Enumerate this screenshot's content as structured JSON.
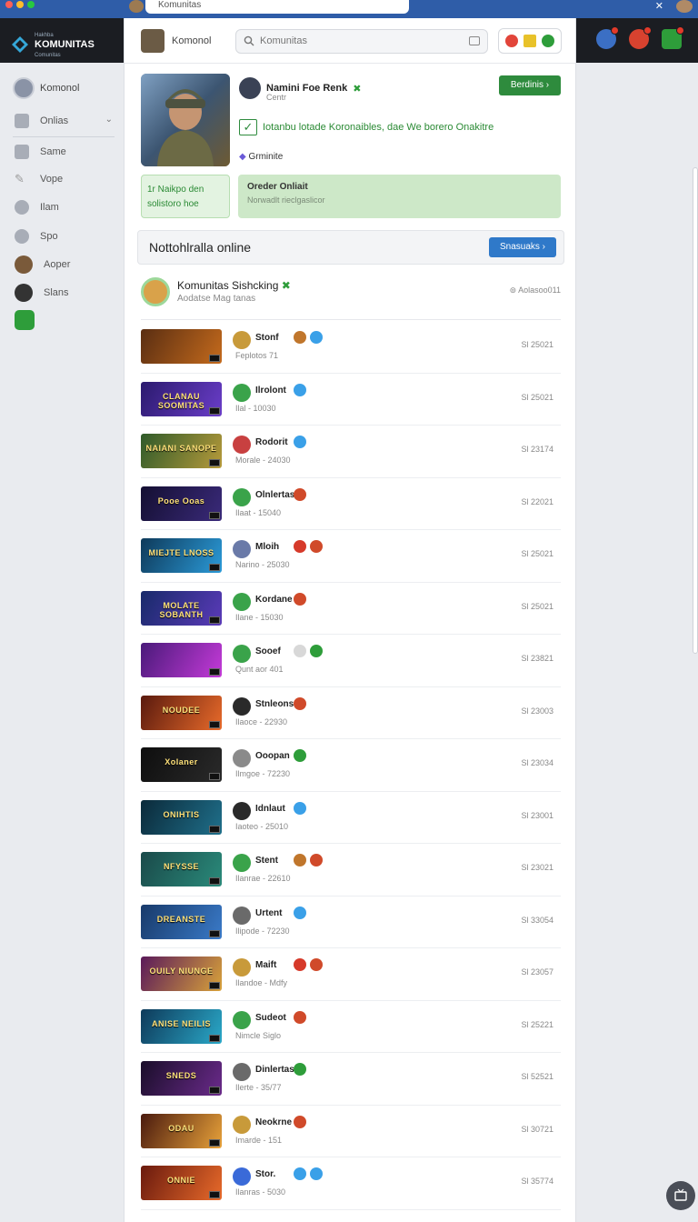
{
  "browser": {
    "tab_title": "Komunitas"
  },
  "header": {
    "brand_line1": "Hakhba",
    "brand_line2": "KOMUNITAS",
    "brand_line3": "Comunitas"
  },
  "sidebar": {
    "user": "Komonol",
    "items": [
      {
        "label": "Onlias",
        "icon": "folder-icon",
        "caret": true
      },
      {
        "label": "Same",
        "icon": "bookmark-icon"
      },
      {
        "label": "Vope",
        "icon": "pencil-icon"
      },
      {
        "label": "Ilam",
        "icon": "letter-e-icon"
      },
      {
        "label": "Spo",
        "icon": "circle-icon"
      },
      {
        "label": "Aoper",
        "icon": "character-icon"
      },
      {
        "label": "Slans",
        "icon": "info-icon"
      },
      {
        "label": "",
        "icon": "chat-icon"
      }
    ]
  },
  "searchrow": {
    "user_name": "Komonol",
    "search_placeholder": "Komunitas"
  },
  "profile": {
    "name": "Namini Foe Renk",
    "subtitle": "Centr",
    "follow_label": "Berdinis",
    "description": "Iotanbu lotade Koronaibles, dae We borero Onakitre",
    "genre": "Grminite",
    "tile_a": "1r Naikpo den solistoro hoe",
    "tile_b_title": "Oreder Onliait",
    "tile_b_sub": "Norwadlt rieclgaslicor"
  },
  "online_bar": {
    "title": "Nottohlralla online",
    "button": "Snasuaks"
  },
  "community": {
    "title": "Komunitas Sishcking",
    "subtitle": "Aodatse Mag tanas",
    "right": "Aolasoo011"
  },
  "rows": [
    {
      "thumb_text": "",
      "name": "Stonf",
      "sub": "Feplotos 71",
      "value": "Sl 25021",
      "thumb_colors": [
        "#5a2e12",
        "#c46a1c"
      ],
      "av": "#c89a3a",
      "icons": [
        "#c0762c",
        "#3aa0e8"
      ]
    },
    {
      "thumb_text": "CLANAU SOOMITAS",
      "name": "Ilrolont",
      "sub": "Ilal - 10030",
      "value": "Sl 25021",
      "thumb_colors": [
        "#2b1a6e",
        "#6a3dc8"
      ],
      "av": "#3aa34a",
      "icons": [
        "#3aa0e8"
      ]
    },
    {
      "thumb_text": "NAIANI SANOPE",
      "name": "Rodorit",
      "sub": "Morale - 24030",
      "value": "Sl 23174",
      "thumb_colors": [
        "#2e5a2a",
        "#b79a3a"
      ],
      "av": "#c84040",
      "icons": [
        "#3aa0e8"
      ]
    },
    {
      "thumb_text": "Pooe Ooas",
      "name": "Olnlertas",
      "sub": "Ilaat - 15040",
      "value": "Sl 22021",
      "thumb_colors": [
        "#140f32",
        "#3a2a7a"
      ],
      "av": "#3aa34a",
      "icons": [
        "#d04a2a"
      ]
    },
    {
      "thumb_text": "MIEJTE LNOSS",
      "name": "Mloih",
      "sub": "Narino - 25030",
      "value": "Sl 25021",
      "thumb_colors": [
        "#0e3a5a",
        "#2b9ad8"
      ],
      "av": "#6a7aa8",
      "icons": [
        "#d63a2a",
        "#d04a2a"
      ]
    },
    {
      "thumb_text": "MOLATE SOBANTH",
      "name": "Kordane",
      "sub": "Ilane - 15030",
      "value": "Sl 25021",
      "thumb_colors": [
        "#182a6a",
        "#5a3ab8"
      ],
      "av": "#3aa34a",
      "icons": [
        "#d04a2a"
      ]
    },
    {
      "thumb_text": "",
      "name": "Sooef",
      "sub": "Qunt aor 401",
      "value": "Sl 23821",
      "thumb_colors": [
        "#4a1a7a",
        "#c43ad8"
      ],
      "av": "#3aa34a",
      "icons": [
        "#d8d8d8",
        "#2e9d3a"
      ]
    },
    {
      "thumb_text": "NOUDEE",
      "name": "Stnleons",
      "sub": "Ilaoce - 22930",
      "value": "Sl 23003",
      "thumb_colors": [
        "#5a1a0e",
        "#e86a2a"
      ],
      "av": "#2a2a2a",
      "icons": [
        "#d04a2a"
      ]
    },
    {
      "thumb_text": "Xolaner",
      "name": "Ooopan",
      "sub": "Ilmgoe - 72230",
      "value": "Sl 23034",
      "thumb_colors": [
        "#0e0e0e",
        "#2a2a2a"
      ],
      "av": "#8a8a8a",
      "icons": [
        "#2e9d3a"
      ]
    },
    {
      "thumb_text": "ONIHTIS",
      "name": "Idnlaut",
      "sub": "Iaoteo - 25010",
      "value": "Sl 23001",
      "thumb_colors": [
        "#0b2a3a",
        "#1f6f8a"
      ],
      "av": "#2a2a2a",
      "icons": [
        "#3aa0e8"
      ]
    },
    {
      "thumb_text": "NFYSSE",
      "name": "Stent",
      "sub": "Ilanrae - 22610",
      "value": "Sl 23021",
      "thumb_colors": [
        "#1a4a4a",
        "#2a8a7a"
      ],
      "av": "#3aa34a",
      "icons": [
        "#c0762c",
        "#d04a2a"
      ]
    },
    {
      "thumb_text": "DREANSTE",
      "name": "Urtent",
      "sub": "Ilipode - 72230",
      "value": "Sl 33054",
      "thumb_colors": [
        "#183a6a",
        "#3a7ac8"
      ],
      "av": "#6a6a6a",
      "icons": [
        "#3aa0e8"
      ]
    },
    {
      "thumb_text": "OUILY NIUNGE",
      "name": "Maift",
      "sub": "Ilandoe - Mdfy",
      "value": "Sl 23057",
      "thumb_colors": [
        "#5a1a5a",
        "#d8a23a"
      ],
      "av": "#c89a3a",
      "icons": [
        "#d63a2a",
        "#d04a2a"
      ]
    },
    {
      "thumb_text": "ANISE NEILIS",
      "name": "Sudeot",
      "sub": "Nimcle Siglo",
      "value": "Sl 25221",
      "thumb_colors": [
        "#0e3a5a",
        "#2aa8c8"
      ],
      "av": "#3aa34a",
      "icons": [
        "#d04a2a"
      ]
    },
    {
      "thumb_text": "SNEDS",
      "name": "Dinlertas",
      "sub": "Ilerte - 35/77",
      "value": "Sl 52521",
      "thumb_colors": [
        "#1a0e2a",
        "#6a2a8a"
      ],
      "av": "#6a6a6a",
      "icons": [
        "#2e9d3a"
      ]
    },
    {
      "thumb_text": "ODAU",
      "name": "Neokrne",
      "sub": "Imarde - 151",
      "value": "Sl 30721",
      "thumb_colors": [
        "#4a1a0e",
        "#e8a23a"
      ],
      "av": "#c89a3a",
      "icons": [
        "#d04a2a"
      ]
    },
    {
      "thumb_text": "ONNIE",
      "name": "Stor.",
      "sub": "Ilanras - 5030",
      "value": "Sl 35774",
      "thumb_colors": [
        "#6a1a0e",
        "#e86a2a"
      ],
      "av": "#3a6ad8",
      "icons": [
        "#3aa0e8",
        "#3aa0e8"
      ]
    }
  ],
  "colors": {
    "accent_green": "#2e8b3d",
    "accent_blue": "#2f79c9",
    "header_bg": "#1b1d22"
  }
}
